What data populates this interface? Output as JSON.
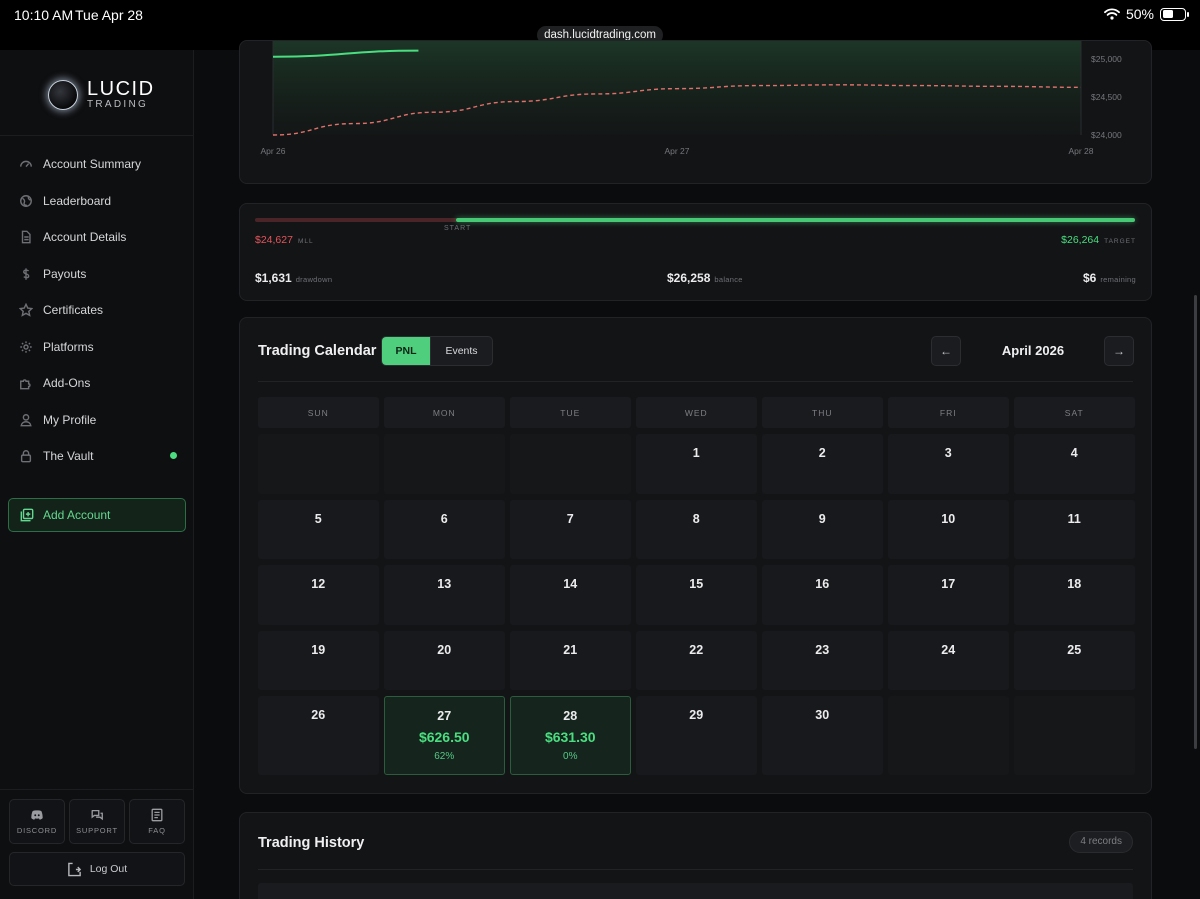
{
  "status_bar": {
    "time": "10:10 AM",
    "date": "Tue Apr 28",
    "battery": "50%",
    "battery_level": 0.5
  },
  "browser": {
    "url": "dash.lucidtrading.com"
  },
  "brand": {
    "name": "LUCID",
    "sub": "TRADING"
  },
  "sidebar": {
    "items": [
      {
        "label": "Account Summary",
        "icon": "gauge-icon"
      },
      {
        "label": "Leaderboard",
        "icon": "globe-icon"
      },
      {
        "label": "Account Details",
        "icon": "document-icon"
      },
      {
        "label": "Payouts",
        "icon": "dollar-icon"
      },
      {
        "label": "Certificates",
        "icon": "star-icon"
      },
      {
        "label": "Platforms",
        "icon": "gear-icon"
      },
      {
        "label": "Add-Ons",
        "icon": "puzzle-icon"
      },
      {
        "label": "My Profile",
        "icon": "user-icon"
      },
      {
        "label": "The Vault",
        "icon": "lock-icon"
      }
    ],
    "add_account": "Add Account",
    "bottom": {
      "discord": "DISCORD",
      "support": "SUPPORT",
      "faq": "FAQ"
    },
    "logout": "Log Out"
  },
  "chart_data": {
    "type": "area",
    "x_ticks": [
      "Apr 26",
      "Apr 27",
      "Apr 28"
    ],
    "y_ticks": [
      "$25,000",
      "$24,500",
      "$24,000"
    ],
    "ylim": [
      24000,
      25000
    ],
    "series": [
      {
        "style": "solid",
        "x": [
          0.0,
          0.18
        ],
        "values": [
          25030,
          25110
        ]
      },
      {
        "style": "dashed",
        "x": [
          0.0,
          0.1,
          0.2,
          0.3,
          0.4,
          0.5,
          0.6,
          0.7,
          0.8,
          0.9,
          1.0
        ],
        "values": [
          24000,
          24150,
          24300,
          24440,
          24540,
          24610,
          24650,
          24660,
          24650,
          24640,
          24627
        ]
      }
    ]
  },
  "progress": {
    "mll_value": "$24,627",
    "mll_label": "MLL",
    "start_label": "START",
    "start_fraction": 0.228,
    "target_value": "$26,264",
    "target_label": "TARGET",
    "progress_fraction": 1.0,
    "drawdown_value": "$1,631",
    "drawdown_label": "drawdown",
    "balance_value": "$26,258",
    "balance_label": "balance",
    "remaining_value": "$6",
    "remaining_label": "remaining"
  },
  "calendar": {
    "title": "Trading Calendar",
    "toggle": {
      "pnl": "PNL",
      "events": "Events"
    },
    "month": "April 2026",
    "prev": "←",
    "next": "→",
    "weekdays": [
      "SUN",
      "MON",
      "TUE",
      "WED",
      "THU",
      "FRI",
      "SAT"
    ],
    "days": [
      {
        "d": ""
      },
      {
        "d": ""
      },
      {
        "d": ""
      },
      {
        "d": "1"
      },
      {
        "d": "2"
      },
      {
        "d": "3"
      },
      {
        "d": "4"
      },
      {
        "d": "5"
      },
      {
        "d": "6"
      },
      {
        "d": "7"
      },
      {
        "d": "8"
      },
      {
        "d": "9"
      },
      {
        "d": "10"
      },
      {
        "d": "11"
      },
      {
        "d": "12"
      },
      {
        "d": "13"
      },
      {
        "d": "14"
      },
      {
        "d": "15"
      },
      {
        "d": "16"
      },
      {
        "d": "17"
      },
      {
        "d": "18"
      },
      {
        "d": "19"
      },
      {
        "d": "20"
      },
      {
        "d": "21"
      },
      {
        "d": "22"
      },
      {
        "d": "23"
      },
      {
        "d": "24"
      },
      {
        "d": "25"
      },
      {
        "d": "26"
      },
      {
        "d": "27",
        "pnl": "$626.50",
        "pct": "62%"
      },
      {
        "d": "28",
        "pnl": "$631.30",
        "pct": "0%"
      },
      {
        "d": "29"
      },
      {
        "d": "30"
      },
      {
        "d": ""
      },
      {
        "d": ""
      }
    ]
  },
  "history": {
    "title": "Trading History",
    "records": "4 records"
  }
}
